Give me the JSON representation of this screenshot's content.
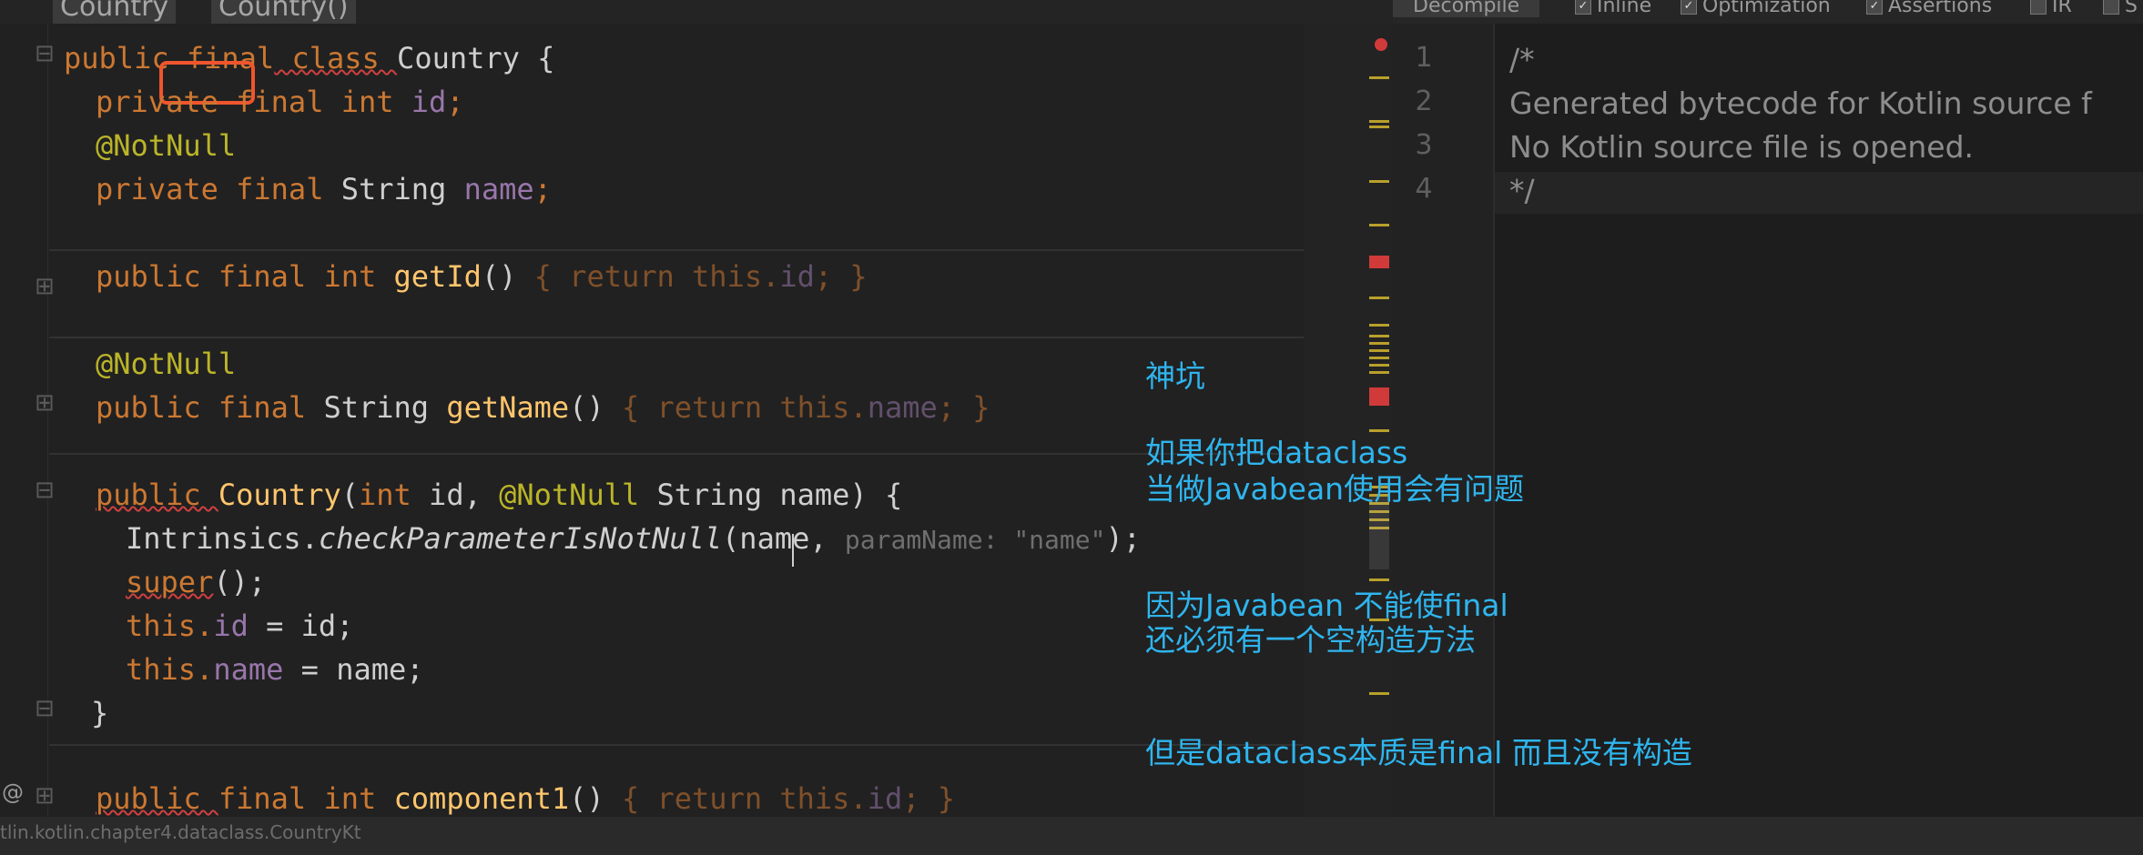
{
  "tabs": [
    "Country",
    "Country()"
  ],
  "editor": {
    "lines": [
      [
        "public ",
        "final",
        " class ",
        "Country",
        " {"
      ],
      [
        "private final int ",
        "id",
        ";"
      ],
      [
        "@NotNull"
      ],
      [
        "private final ",
        "String ",
        "name",
        ";"
      ],
      [
        "public final int ",
        "getId",
        "() ",
        "{ return this.",
        "id",
        "; }"
      ],
      [
        "@NotNull"
      ],
      [
        "public final ",
        "String ",
        "getName",
        "() ",
        "{ return this.",
        "name",
        "; }"
      ],
      [
        "public ",
        "Country",
        "(",
        "int ",
        "id, ",
        "@NotNull ",
        "String name) {"
      ],
      [
        "Intrinsics.",
        "checkParameterIsNotNull",
        "(name, ",
        "paramName: ",
        "\"name\"",
        ");"
      ],
      [
        "super",
        "();"
      ],
      [
        "this.",
        "id",
        " = id;"
      ],
      [
        "this.",
        "name",
        " = name;"
      ],
      [
        "}"
      ],
      [
        "public ",
        "final int ",
        "component1",
        "() ",
        "{ return this.",
        "id",
        "; }"
      ]
    ],
    "gutter_marker": "@"
  },
  "bytecode": {
    "toolbar": {
      "decompile": "Decompile",
      "inline": "Inline",
      "optimization": "Optimization",
      "assertions": "Assertions",
      "ir": "IR",
      "s": "S"
    },
    "line_numbers": [
      "1",
      "2",
      "3",
      "4"
    ],
    "lines": [
      "/*",
      "Generated bytecode for Kotlin source f",
      "No Kotlin source file is opened.",
      "*/"
    ]
  },
  "statusbar": {
    "text": "tlin.kotlin.chapter4.dataclass.CountryKt"
  },
  "notes": [
    "神坑",
    "如果你把dataclass",
    "当做Javabean使用会有问题",
    "因为Javabean  不能使final",
    "还必须有一个空构造方法",
    "但是dataclass本质是final 而且没有构造"
  ],
  "colors": {
    "keyword": "#cc7832",
    "annotation": "#bbb529",
    "field": "#9876aa",
    "method": "#ffc66d",
    "string": "#6a8759",
    "highlight_box": "#f0552e",
    "note_text": "#2fb5ee"
  }
}
